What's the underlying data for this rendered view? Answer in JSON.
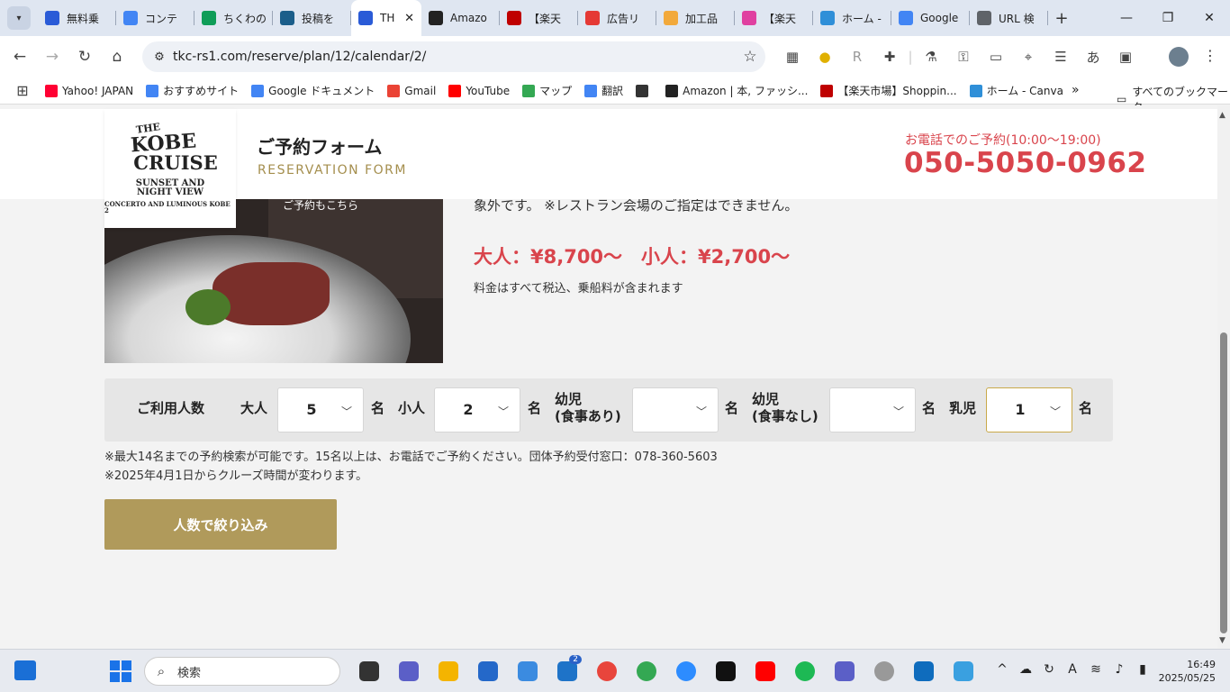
{
  "browser": {
    "tabs": [
      {
        "label": "無料乗",
        "icon": "fork-knife-icon",
        "color": "#2a5bd7"
      },
      {
        "label": "コンテ",
        "icon": "docs-icon",
        "color": "#4285f4"
      },
      {
        "label": "ちくわの",
        "icon": "sheets-icon",
        "color": "#0f9d58"
      },
      {
        "label": "投稿を",
        "icon": "site-icon",
        "color": "#1b5e8a"
      },
      {
        "label": "TH",
        "icon": "fork-knife-icon",
        "color": "#2a5bd7",
        "active": true
      },
      {
        "label": "Amazo",
        "icon": "amazon-icon",
        "color": "#222222"
      },
      {
        "label": "【楽天",
        "icon": "rakuten-icon",
        "color": "#bf0000"
      },
      {
        "label": "広告リ",
        "icon": "ad-icon",
        "color": "#e53935"
      },
      {
        "label": "加工品",
        "icon": "star-badge-icon",
        "color": "#f2a93b"
      },
      {
        "label": "【楽天",
        "icon": "rakuten-icon",
        "color": "#e040a0"
      },
      {
        "label": "ホーム -",
        "icon": "canva-icon",
        "color": "#2f8fd8"
      },
      {
        "label": "Google",
        "icon": "translate-icon",
        "color": "#4285f4"
      },
      {
        "label": "URL 検",
        "icon": "link-icon",
        "color": "#5f6368"
      }
    ],
    "url": "tkc-rs1.com/reserve/plan/12/calendar/2/",
    "bookmarks": [
      {
        "label": "Yahoo! JAPAN",
        "color": "#ff0033"
      },
      {
        "label": "おすすめサイト",
        "color": "#4285f4"
      },
      {
        "label": "Google ドキュメント",
        "color": "#4285f4"
      },
      {
        "label": "Gmail",
        "color": "#ea4335"
      },
      {
        "label": "YouTube",
        "color": "#ff0000"
      },
      {
        "label": "マップ",
        "color": "#34a853"
      },
      {
        "label": "翻訳",
        "color": "#4285f4"
      },
      {
        "label": "",
        "color": "#333333"
      },
      {
        "label": "Amazon | 本, ファッシ...",
        "color": "#222222"
      },
      {
        "label": "【楽天市場】Shoppin...",
        "color": "#bf0000"
      },
      {
        "label": "ホーム - Canva",
        "color": "#2f8fd8"
      }
    ],
    "all_bookmarks": "すべてのブックマーク"
  },
  "site": {
    "logo": {
      "line1": "THE",
      "line2": "KOBE",
      "line3": "CRUISE",
      "line4": "SUNSET AND",
      "line5": "NIGHT VIEW",
      "line6": "CONCERTO AND LUMINOUS KOBE 2"
    },
    "form_title": "ご予約フォーム",
    "form_subtitle": "RESERVATION FORM",
    "tel_note": "お電話でのご予約(10:00〜19:00)",
    "tel": "050-5050-0962"
  },
  "plan": {
    "photo_caption": "ご予約もこちら",
    "intro_tail": "象外です。 ※レストラン会場のご指定はできません。",
    "price": "大人：¥8,700〜　小人：¥2,700〜",
    "price_note": "料金はすべて税込、乗船料が含まれます"
  },
  "counts": {
    "heading": "ご利用人数",
    "unit": "名",
    "adult": {
      "label": "大人",
      "value": "5"
    },
    "child": {
      "label": "小人",
      "value": "2"
    },
    "infant_meal": {
      "label": "幼児\n(食事あり)",
      "value": ""
    },
    "infant_nomeal": {
      "label": "幼児\n(食事なし)",
      "value": ""
    },
    "baby": {
      "label": "乳児",
      "value": "1"
    }
  },
  "notes": {
    "line1": "※最大14名までの予約検索が可能です。15名以上は、お電話でご予約ください。団体予約受付窓口：078-360-5603",
    "line2": "※2025年4月1日からクルーズ時間が変わります。"
  },
  "filter_button": "人数で絞り込み",
  "taskbar": {
    "search_placeholder": "検索",
    "time": "16:49",
    "date": "2025/05/25",
    "mail_badge": "2"
  }
}
